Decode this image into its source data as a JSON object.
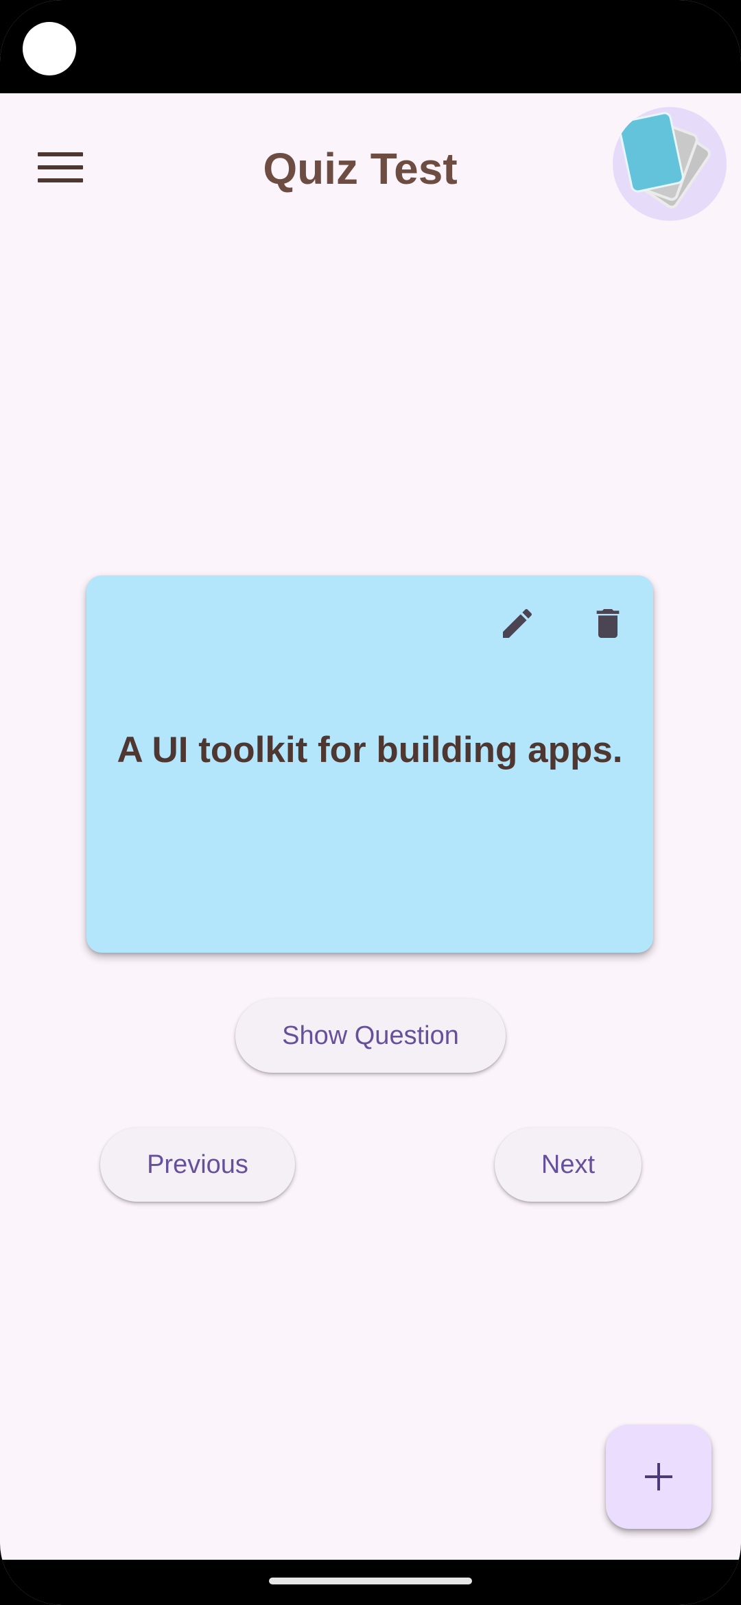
{
  "header": {
    "title": "Quiz Test",
    "menu_icon": "menu-icon",
    "logo_icon": "flashcards-logo"
  },
  "card": {
    "text": "A UI toolkit for building apps.",
    "edit_icon": "pencil-icon",
    "delete_icon": "trash-icon",
    "background_color": "#b3e5fb"
  },
  "controls": {
    "show_question_label": "Show Question",
    "previous_label": "Previous",
    "next_label": "Next"
  },
  "fab": {
    "icon": "plus-icon"
  },
  "colors": {
    "background": "#fcf4fb",
    "title": "#6d4c41",
    "button_text": "#66509c",
    "fab_background": "#eaddfd"
  }
}
